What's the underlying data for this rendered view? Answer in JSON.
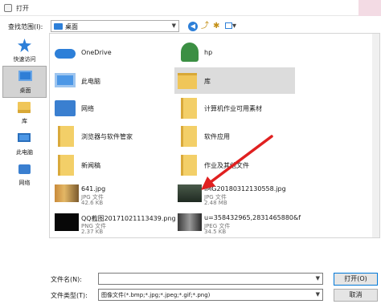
{
  "window": {
    "title": "打开"
  },
  "lookin": {
    "label": "查找范围(I):",
    "value": "桌面"
  },
  "places": [
    {
      "label": "快速访问"
    },
    {
      "label": "桌面"
    },
    {
      "label": "库"
    },
    {
      "label": "此电脑"
    },
    {
      "label": "网络"
    }
  ],
  "files": [
    {
      "name": "OneDrive"
    },
    {
      "name": "hp"
    },
    {
      "name": "此电脑"
    },
    {
      "name": "库"
    },
    {
      "name": "网络"
    },
    {
      "name": "计算机作业可用素材"
    },
    {
      "name": "浏览器与软件管家"
    },
    {
      "name": "软件应用"
    },
    {
      "name": "新闻稿"
    },
    {
      "name": "作业及其他文件"
    },
    {
      "name": "641.jpg",
      "type": "JPG 文件",
      "size": "42.6 KB"
    },
    {
      "name": "IMG20180312130558.jpg",
      "type": "JPG 文件",
      "size": "2.48 MB"
    },
    {
      "name": "QQ截图20171021113439.png",
      "type": "PNG 文件",
      "size": "2.37 KB"
    },
    {
      "name": "u=358432965,2831465880&f",
      "type": "JPEG 文件",
      "size": "34.5 KB"
    }
  ],
  "filename": {
    "label": "文件名(N):",
    "value": ""
  },
  "filetype": {
    "label": "文件类型(T):",
    "value": "图像文件(*.bmp;*.jpg;*.jpeg;*.gif;*.png)"
  },
  "buttons": {
    "open": "打开(O)",
    "cancel": "取消"
  },
  "colors": {
    "accent": "#2d7fd8",
    "selection": "#dcdcdc",
    "arrow": "#e02020",
    "title_accent": "#f3dbe4"
  }
}
